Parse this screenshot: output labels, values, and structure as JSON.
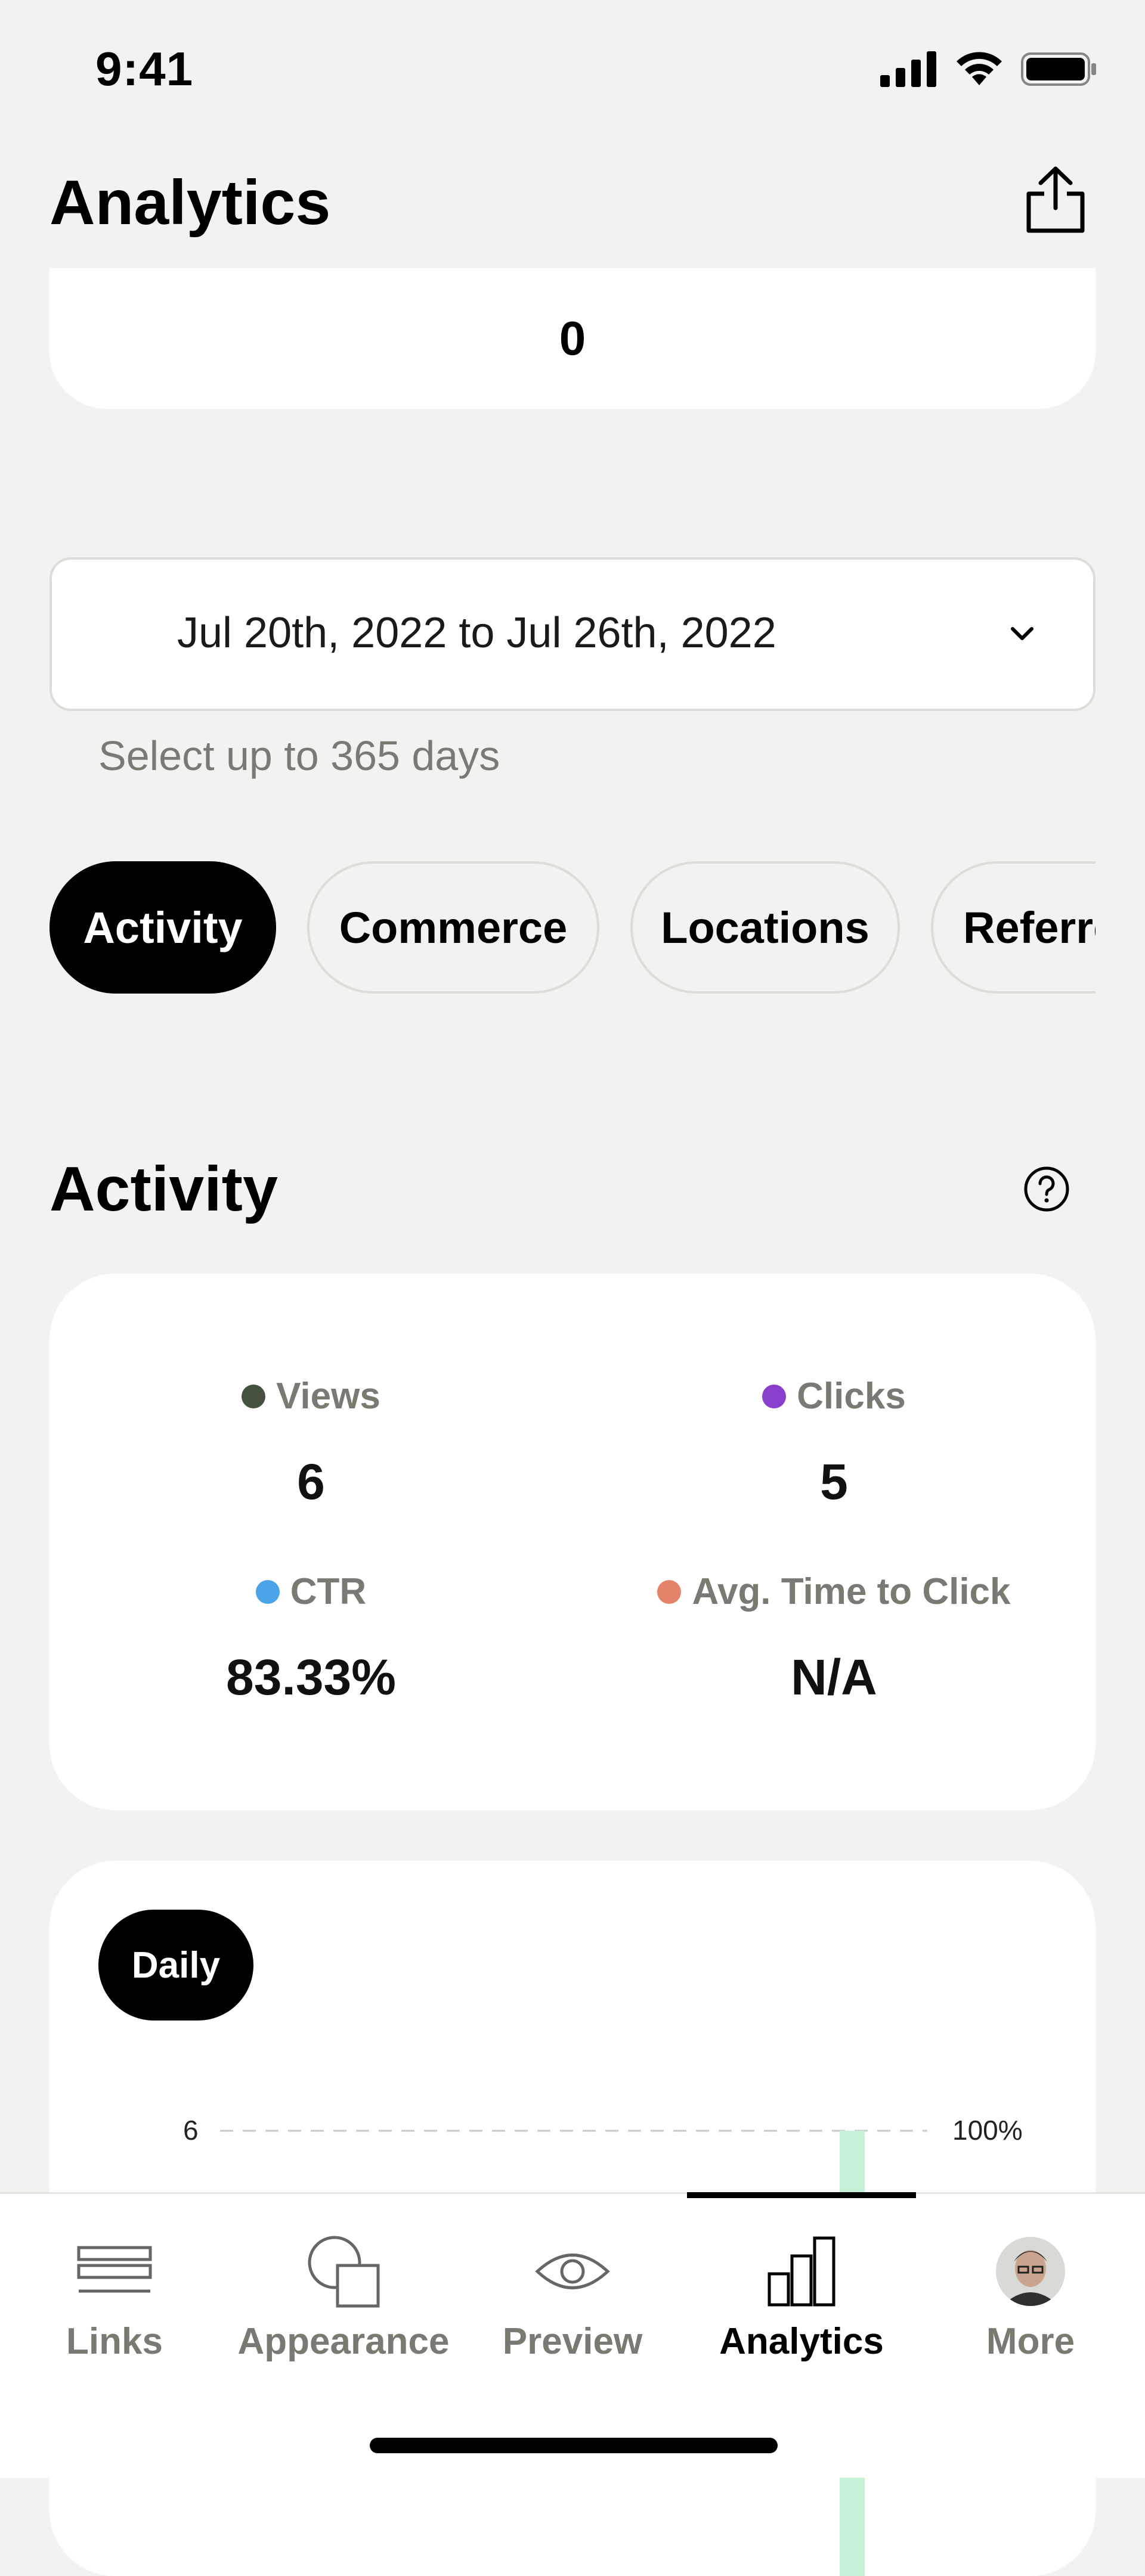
{
  "status_bar": {
    "time": "9:41"
  },
  "header": {
    "title": "Analytics"
  },
  "top_card": {
    "value": "0"
  },
  "date_range": {
    "value": "Jul 20th, 2022 to Jul 26th, 2022",
    "helper": "Select up to 365 days"
  },
  "tabs": [
    {
      "label": "Activity",
      "active": true
    },
    {
      "label": "Commerce",
      "active": false
    },
    {
      "label": "Locations",
      "active": false
    },
    {
      "label": "Referrers",
      "active": false
    }
  ],
  "activity": {
    "title": "Activity",
    "stats": [
      {
        "label": "Views",
        "value": "6",
        "color": "#47513f"
      },
      {
        "label": "Clicks",
        "value": "5",
        "color": "#8a3fcc"
      },
      {
        "label": "CTR",
        "value": "83.33%",
        "color": "#4ba3e8"
      },
      {
        "label": "Avg. Time to Click",
        "value": "N/A",
        "color": "#e5826a"
      }
    ]
  },
  "chart": {
    "period_label": "Daily",
    "bar_color": "#c5f2d6"
  },
  "chart_data": {
    "type": "bar",
    "y_left_ticks": [
      "6"
    ],
    "y_right_ticks": [
      "100%"
    ],
    "ylim": [
      0,
      6
    ],
    "values": [
      6
    ]
  },
  "bottom_nav": [
    {
      "label": "Links",
      "icon": "links-icon",
      "active": false
    },
    {
      "label": "Appearance",
      "icon": "appearance-icon",
      "active": false
    },
    {
      "label": "Preview",
      "icon": "eye-icon",
      "active": false
    },
    {
      "label": "Analytics",
      "icon": "bar-chart-icon",
      "active": true
    },
    {
      "label": "More",
      "icon": "avatar",
      "active": false
    }
  ]
}
